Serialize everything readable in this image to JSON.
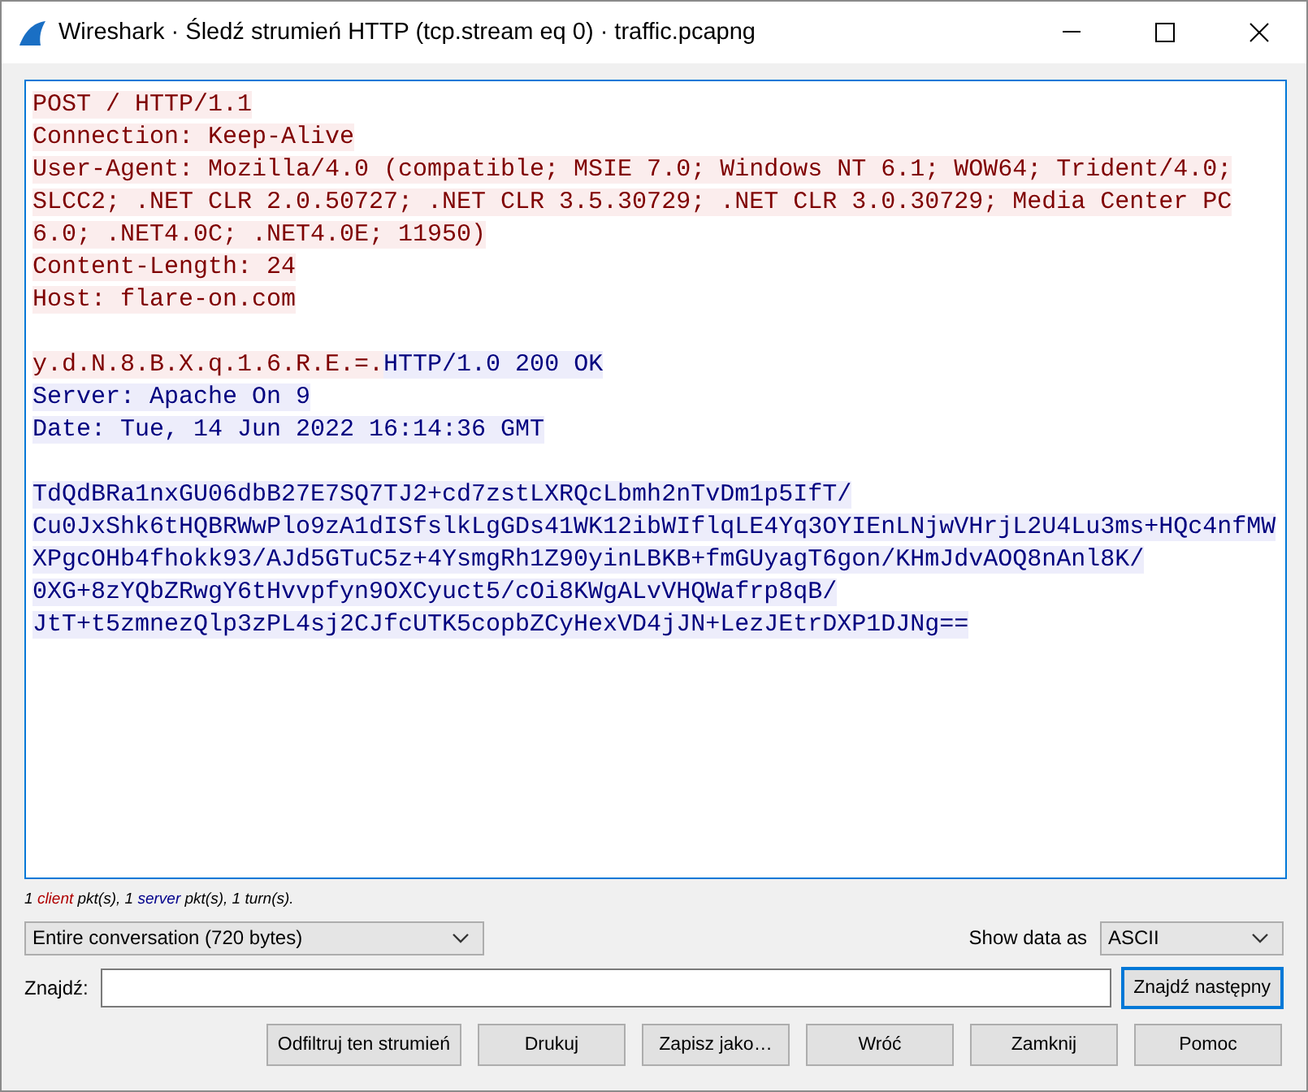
{
  "window": {
    "title": "Wireshark · Śledź strumień HTTP (tcp.stream eq 0) · traffic.pcapng"
  },
  "stream": {
    "blocks": [
      {
        "lines": [
          {
            "segments": [
              {
                "text": "POST / HTTP/1.1",
                "server": false
              }
            ]
          },
          {
            "segments": [
              {
                "text": "Connection: Keep-Alive",
                "server": false
              }
            ]
          },
          {
            "segments": [
              {
                "text": "User-Agent: Mozilla/4.0 (compatible; MSIE 7.0; Windows NT 6.1; WOW64; Trident/4.0;",
                "server": false
              }
            ]
          },
          {
            "segments": [
              {
                "text": "SLCC2; .NET CLR 2.0.50727; .NET CLR 3.5.30729; .NET CLR 3.0.30729; Media Center PC",
                "server": false
              }
            ]
          },
          {
            "segments": [
              {
                "text": "6.0; .NET4.0C; .NET4.0E; 11950)",
                "server": false
              }
            ]
          },
          {
            "segments": [
              {
                "text": "Content-Length: 24",
                "server": false
              }
            ]
          },
          {
            "segments": [
              {
                "text": "Host: flare-on.com",
                "server": false
              }
            ]
          }
        ]
      },
      {
        "lines": [
          {
            "segments": [
              {
                "text": "y.d.N.8.B.X.q.1.6.R.E.=.",
                "server": false
              },
              {
                "text": "HTTP/1.0 200 OK",
                "server": true
              }
            ]
          },
          {
            "segments": [
              {
                "text": "Server: Apache On 9",
                "server": true
              }
            ]
          },
          {
            "segments": [
              {
                "text": "Date: Tue, 14 Jun 2022 16:14:36 GMT",
                "server": true
              }
            ]
          }
        ]
      },
      {
        "lines": [
          {
            "segments": [
              {
                "text": "TdQdBRa1nxGU06dbB27E7SQ7TJ2+cd7zstLXRQcLbmh2nTvDm1p5IfT/",
                "server": true
              }
            ]
          },
          {
            "segments": [
              {
                "text": "Cu0JxShk6tHQBRWwPlo9zA1dISfslkLgGDs41WK12ibWIflqLE4Yq3OYIEnLNjwVHrjL2U4Lu3ms+HQc4nfMW",
                "server": true
              }
            ]
          },
          {
            "segments": [
              {
                "text": "XPgcOHb4fhokk93/AJd5GTuC5z+4YsmgRh1Z90yinLBKB+fmGUyagT6gon/KHmJdvAOQ8nAnl8K/",
                "server": true
              }
            ]
          },
          {
            "segments": [
              {
                "text": "0XG+8zYQbZRwgY6tHvvpfyn9OXCyuct5/cOi8KWgALvVHQWafrp8qB/",
                "server": true
              }
            ]
          },
          {
            "segments": [
              {
                "text": "JtT+t5zmnezQlp3zPL4sj2CJfcUTK5copbZCyHexVD4jJN+LezJEtrDXP1DJNg==",
                "server": true
              }
            ]
          }
        ]
      }
    ]
  },
  "stats": [
    {
      "text": "1 "
    },
    {
      "text": "client",
      "color": "#b00000"
    },
    {
      "text": " pkt(s), 1 "
    },
    {
      "text": "server",
      "color": "#00008b"
    },
    {
      "text": " pkt(s), 1 turn(s)."
    }
  ],
  "conversation_dropdown": {
    "value": "Entire conversation (720 bytes)"
  },
  "show_data_as": {
    "label": "Show data as",
    "value": "ASCII"
  },
  "find": {
    "label": "Znajdź:",
    "button": "Znajdź następny",
    "button_focused": true
  },
  "buttons": [
    "Odfiltruj ten strumień",
    "Drukuj",
    "Zapisz jako…",
    "Wróć",
    "Zamknij",
    "Pomoc"
  ]
}
